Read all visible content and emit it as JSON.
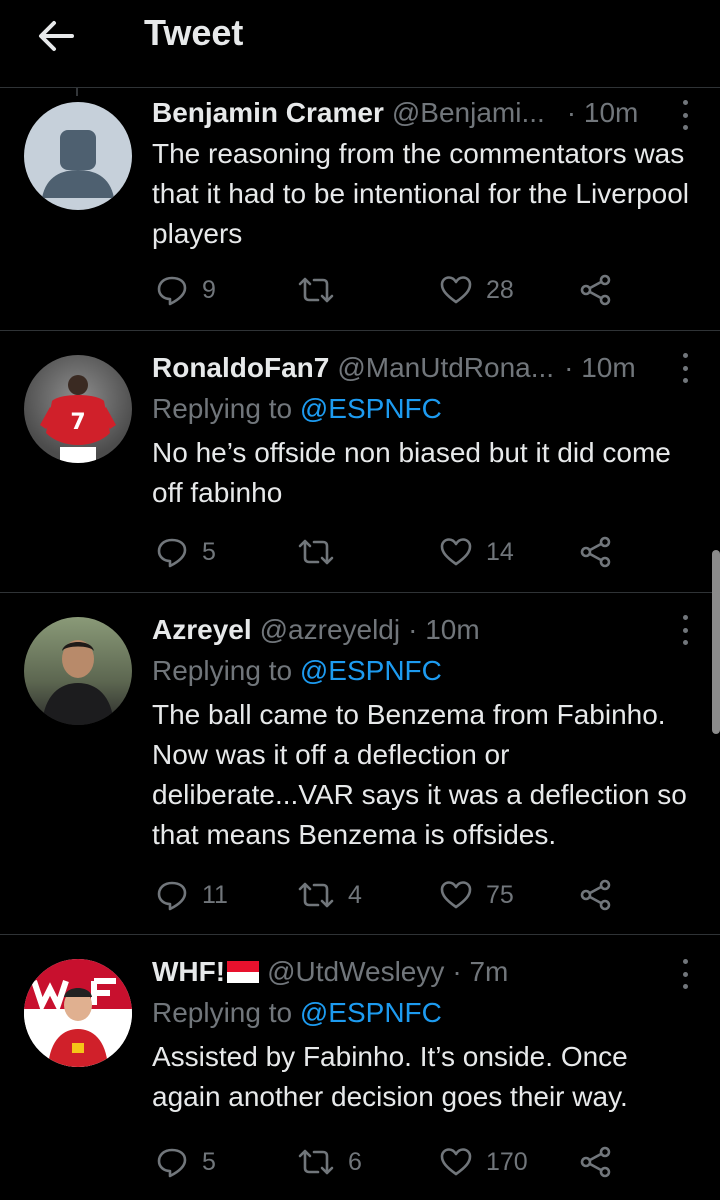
{
  "header": {
    "title": "Tweet",
    "back_icon": "arrow-left-icon"
  },
  "tweets": [
    {
      "name": "Benjamin Cramer",
      "handle": "@Benjami...",
      "time": "· 10m",
      "reply_prefix": "",
      "reply_to": "",
      "text": "The reasoning from the commentators was that it had to be intentional for the Liverpool players",
      "replies": "9",
      "retweets": "",
      "likes": "28"
    },
    {
      "name": "RonaldoFan7",
      "handle": "@ManUtdRona...",
      "time": "· 10m",
      "reply_prefix": "Replying to",
      "reply_to": "@ESPNFC",
      "text": "No he’s offside non biased but it did come off fabinho",
      "replies": "5",
      "retweets": "",
      "likes": "14"
    },
    {
      "name": "Azreyel",
      "handle": "@azreyeldj",
      "time": "· 10m",
      "reply_prefix": "Replying to",
      "reply_to": "@ESPNFC",
      "text": "The ball came to Benzema from Fabinho. Now was it off a deflection or deliberate...VAR says it was a deflection so that means Benzema is offsides.",
      "replies": "11",
      "retweets": "4",
      "likes": "75"
    },
    {
      "name": "WHF!",
      "handle": "@UtdWesleyy",
      "time": "· 7m",
      "reply_prefix": "Replying to",
      "reply_to": "@ESPNFC",
      "text": "Assisted by Fabinho. It’s onside. Once again another decision goes their way.",
      "replies": "5",
      "retweets": "6",
      "likes": "170"
    }
  ],
  "colors": {
    "background": "#000000",
    "text": "#e7e9ea",
    "muted": "#71767b",
    "link": "#1d9bf0",
    "divider": "#2f3336"
  }
}
